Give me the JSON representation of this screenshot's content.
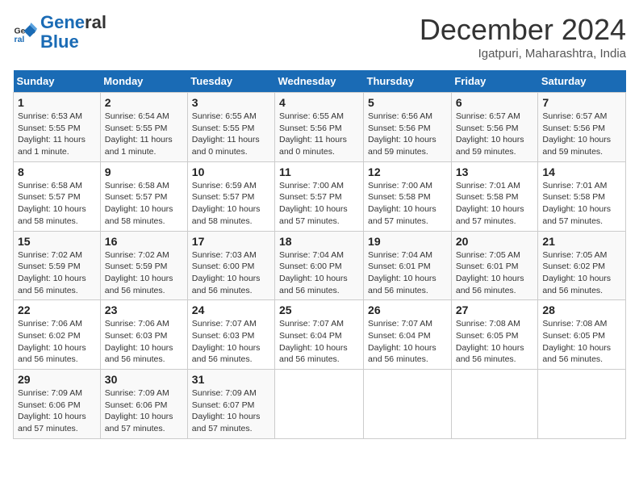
{
  "logo": {
    "line1": "General",
    "line2": "Blue"
  },
  "title": "December 2024",
  "location": "Igatpuri, Maharashtra, India",
  "days_of_week": [
    "Sunday",
    "Monday",
    "Tuesday",
    "Wednesday",
    "Thursday",
    "Friday",
    "Saturday"
  ],
  "weeks": [
    [
      {
        "num": "1",
        "info": "Sunrise: 6:53 AM\nSunset: 5:55 PM\nDaylight: 11 hours\nand 1 minute."
      },
      {
        "num": "2",
        "info": "Sunrise: 6:54 AM\nSunset: 5:55 PM\nDaylight: 11 hours\nand 1 minute."
      },
      {
        "num": "3",
        "info": "Sunrise: 6:55 AM\nSunset: 5:55 PM\nDaylight: 11 hours\nand 0 minutes."
      },
      {
        "num": "4",
        "info": "Sunrise: 6:55 AM\nSunset: 5:56 PM\nDaylight: 11 hours\nand 0 minutes."
      },
      {
        "num": "5",
        "info": "Sunrise: 6:56 AM\nSunset: 5:56 PM\nDaylight: 10 hours\nand 59 minutes."
      },
      {
        "num": "6",
        "info": "Sunrise: 6:57 AM\nSunset: 5:56 PM\nDaylight: 10 hours\nand 59 minutes."
      },
      {
        "num": "7",
        "info": "Sunrise: 6:57 AM\nSunset: 5:56 PM\nDaylight: 10 hours\nand 59 minutes."
      }
    ],
    [
      {
        "num": "8",
        "info": "Sunrise: 6:58 AM\nSunset: 5:57 PM\nDaylight: 10 hours\nand 58 minutes."
      },
      {
        "num": "9",
        "info": "Sunrise: 6:58 AM\nSunset: 5:57 PM\nDaylight: 10 hours\nand 58 minutes."
      },
      {
        "num": "10",
        "info": "Sunrise: 6:59 AM\nSunset: 5:57 PM\nDaylight: 10 hours\nand 58 minutes."
      },
      {
        "num": "11",
        "info": "Sunrise: 7:00 AM\nSunset: 5:57 PM\nDaylight: 10 hours\nand 57 minutes."
      },
      {
        "num": "12",
        "info": "Sunrise: 7:00 AM\nSunset: 5:58 PM\nDaylight: 10 hours\nand 57 minutes."
      },
      {
        "num": "13",
        "info": "Sunrise: 7:01 AM\nSunset: 5:58 PM\nDaylight: 10 hours\nand 57 minutes."
      },
      {
        "num": "14",
        "info": "Sunrise: 7:01 AM\nSunset: 5:58 PM\nDaylight: 10 hours\nand 57 minutes."
      }
    ],
    [
      {
        "num": "15",
        "info": "Sunrise: 7:02 AM\nSunset: 5:59 PM\nDaylight: 10 hours\nand 56 minutes."
      },
      {
        "num": "16",
        "info": "Sunrise: 7:02 AM\nSunset: 5:59 PM\nDaylight: 10 hours\nand 56 minutes."
      },
      {
        "num": "17",
        "info": "Sunrise: 7:03 AM\nSunset: 6:00 PM\nDaylight: 10 hours\nand 56 minutes."
      },
      {
        "num": "18",
        "info": "Sunrise: 7:04 AM\nSunset: 6:00 PM\nDaylight: 10 hours\nand 56 minutes."
      },
      {
        "num": "19",
        "info": "Sunrise: 7:04 AM\nSunset: 6:01 PM\nDaylight: 10 hours\nand 56 minutes."
      },
      {
        "num": "20",
        "info": "Sunrise: 7:05 AM\nSunset: 6:01 PM\nDaylight: 10 hours\nand 56 minutes."
      },
      {
        "num": "21",
        "info": "Sunrise: 7:05 AM\nSunset: 6:02 PM\nDaylight: 10 hours\nand 56 minutes."
      }
    ],
    [
      {
        "num": "22",
        "info": "Sunrise: 7:06 AM\nSunset: 6:02 PM\nDaylight: 10 hours\nand 56 minutes."
      },
      {
        "num": "23",
        "info": "Sunrise: 7:06 AM\nSunset: 6:03 PM\nDaylight: 10 hours\nand 56 minutes."
      },
      {
        "num": "24",
        "info": "Sunrise: 7:07 AM\nSunset: 6:03 PM\nDaylight: 10 hours\nand 56 minutes."
      },
      {
        "num": "25",
        "info": "Sunrise: 7:07 AM\nSunset: 6:04 PM\nDaylight: 10 hours\nand 56 minutes."
      },
      {
        "num": "26",
        "info": "Sunrise: 7:07 AM\nSunset: 6:04 PM\nDaylight: 10 hours\nand 56 minutes."
      },
      {
        "num": "27",
        "info": "Sunrise: 7:08 AM\nSunset: 6:05 PM\nDaylight: 10 hours\nand 56 minutes."
      },
      {
        "num": "28",
        "info": "Sunrise: 7:08 AM\nSunset: 6:05 PM\nDaylight: 10 hours\nand 56 minutes."
      }
    ],
    [
      {
        "num": "29",
        "info": "Sunrise: 7:09 AM\nSunset: 6:06 PM\nDaylight: 10 hours\nand 57 minutes."
      },
      {
        "num": "30",
        "info": "Sunrise: 7:09 AM\nSunset: 6:06 PM\nDaylight: 10 hours\nand 57 minutes."
      },
      {
        "num": "31",
        "info": "Sunrise: 7:09 AM\nSunset: 6:07 PM\nDaylight: 10 hours\nand 57 minutes."
      },
      null,
      null,
      null,
      null
    ]
  ]
}
